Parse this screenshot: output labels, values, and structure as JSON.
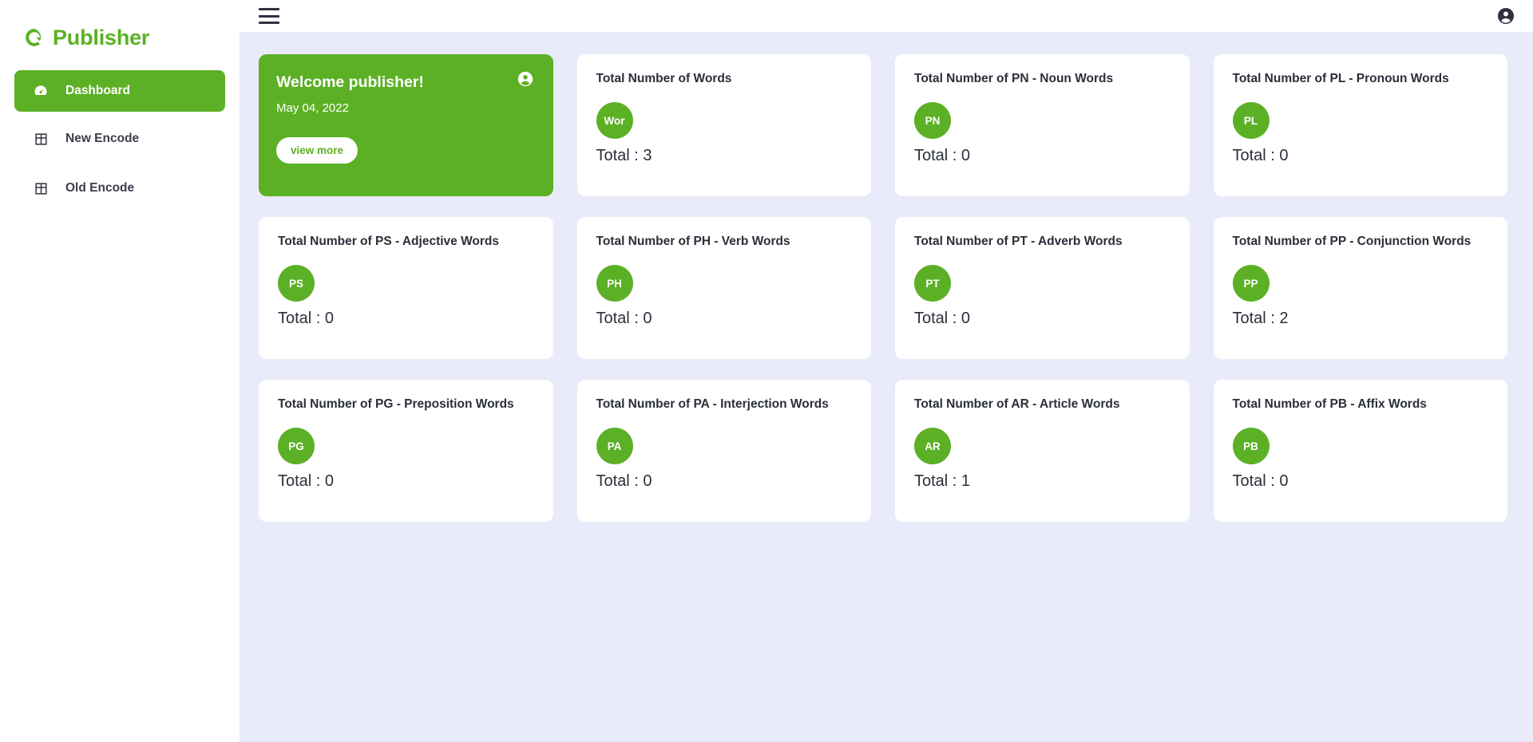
{
  "brand": {
    "name": "Publisher",
    "logo_icon": "circle-c-logo-icon",
    "accent_color": "#5cb025"
  },
  "sidebar": {
    "items": [
      {
        "label": "Dashboard",
        "icon": "gauge-icon",
        "active": true
      },
      {
        "label": "New Encode",
        "icon": "table-icon",
        "active": false
      },
      {
        "label": "Old Encode",
        "icon": "table-icon",
        "active": false
      }
    ]
  },
  "topbar": {
    "menu_icon": "hamburger-menu-icon",
    "account_icon": "account-circle-icon"
  },
  "welcome": {
    "title": "Welcome publisher!",
    "date": "May 04, 2022",
    "button_label": "view more",
    "avatar_icon": "account-circle-icon"
  },
  "cards": [
    {
      "title": "Total Number of Words",
      "badge": "Wor",
      "total_label": "Total : 3"
    },
    {
      "title": "Total Number of PN - Noun Words",
      "badge": "PN",
      "total_label": "Total : 0"
    },
    {
      "title": "Total Number of PL - Pronoun Words",
      "badge": "PL",
      "total_label": "Total : 0"
    },
    {
      "title": "Total Number of PS - Adjective Words",
      "badge": "PS",
      "total_label": "Total : 0"
    },
    {
      "title": "Total Number of PH - Verb Words",
      "badge": "PH",
      "total_label": "Total : 0"
    },
    {
      "title": "Total Number of PT - Adverb Words",
      "badge": "PT",
      "total_label": "Total : 0"
    },
    {
      "title": "Total Number of PP - Conjunction Words",
      "badge": "PP",
      "total_label": "Total : 2"
    },
    {
      "title": "Total Number of PG - Preposition Words",
      "badge": "PG",
      "total_label": "Total : 0"
    },
    {
      "title": "Total Number of PA - Interjection Words",
      "badge": "PA",
      "total_label": "Total : 0"
    },
    {
      "title": "Total Number of AR - Article Words",
      "badge": "AR",
      "total_label": "Total : 1"
    },
    {
      "title": "Total Number of PB - Affix Words",
      "badge": "PB",
      "total_label": "Total : 0"
    }
  ]
}
